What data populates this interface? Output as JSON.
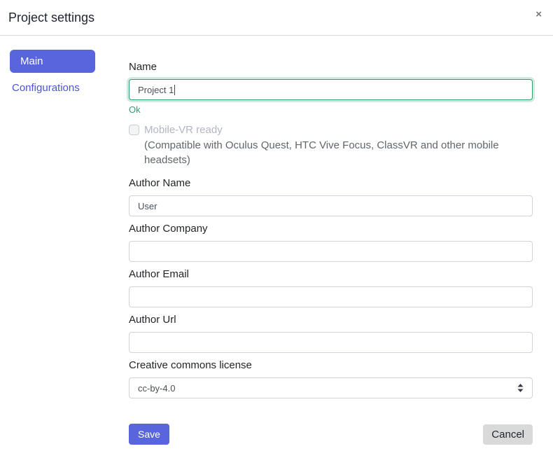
{
  "modal": {
    "title": "Project settings",
    "close_icon": "×"
  },
  "sidebar": {
    "items": [
      {
        "label": "Main",
        "active": true
      },
      {
        "label": "Configurations",
        "active": false
      }
    ]
  },
  "form": {
    "name": {
      "label": "Name",
      "value": "Project 1",
      "validation": "Ok",
      "state": "valid"
    },
    "mobile_vr": {
      "label": "Mobile-VR ready",
      "checked": false,
      "disabled": true,
      "help": "(Compatible with Oculus Quest, HTC Vive Focus, ClassVR and other mobile headsets)"
    },
    "author_name": {
      "label": "Author Name",
      "value": "User"
    },
    "author_company": {
      "label": "Author Company",
      "value": ""
    },
    "author_email": {
      "label": "Author Email",
      "value": ""
    },
    "author_url": {
      "label": "Author Url",
      "value": ""
    },
    "license": {
      "label": "Creative commons license",
      "value": "cc-by-4.0"
    }
  },
  "footer": {
    "save_label": "Save",
    "cancel_label": "Cancel"
  },
  "colors": {
    "primary": "#5865dc",
    "link": "#4b55d2",
    "valid_green": "#2f9e73",
    "cancel_bg": "#d9d9d9",
    "divider": "#d8d8d8",
    "disabled_text": "#b2b6c2"
  }
}
